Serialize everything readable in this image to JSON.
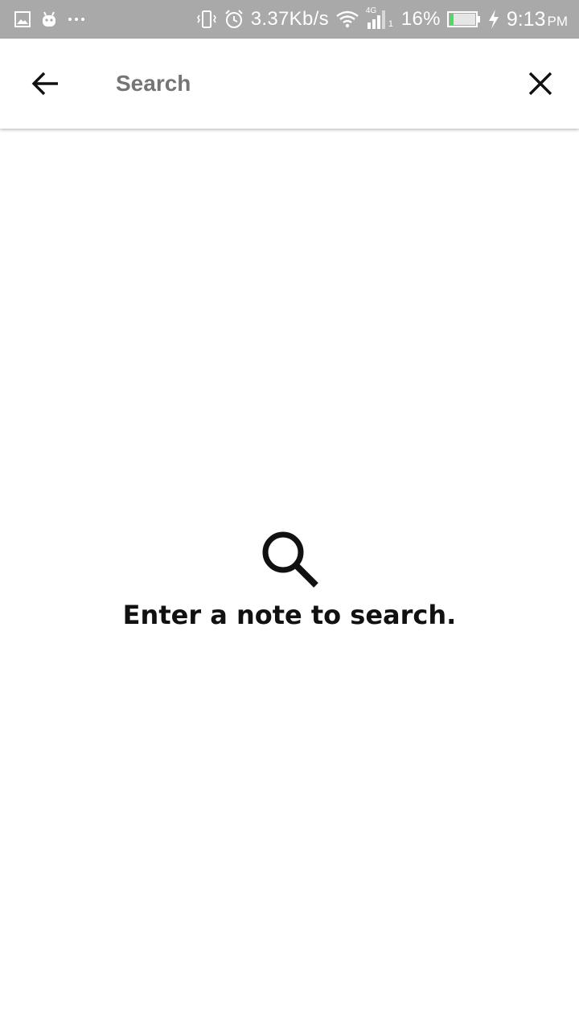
{
  "status_bar": {
    "left_icons": [
      "image-icon",
      "android-icon",
      "more-dots-icon"
    ],
    "vibrate_icon": "vibrate-icon",
    "alarm_icon": "alarm-icon",
    "network_speed": "3.37Kb/s",
    "wifi_icon": "wifi-icon",
    "cell_label": "4G",
    "cell_slot": "1",
    "battery_percent": "16%",
    "battery_level": 0.16,
    "battery_fill_color": "#4cd964",
    "charging_icon": "bolt-icon",
    "time": "9:13",
    "ampm": "PM",
    "background_color": "#a9a9a9"
  },
  "search_bar": {
    "back_icon": "arrow-back-icon",
    "placeholder": "Search",
    "value": "",
    "clear_icon": "close-icon"
  },
  "empty_state": {
    "icon": "search-icon",
    "message": "Enter a note to search."
  }
}
